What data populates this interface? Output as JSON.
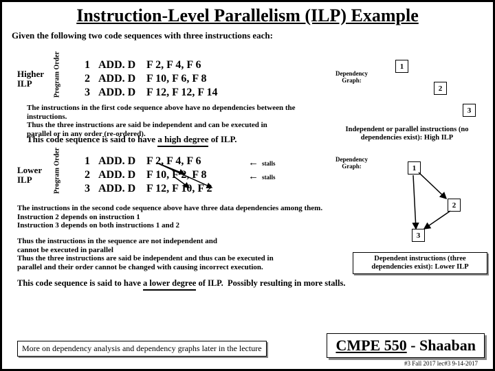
{
  "title": "Instruction-Level Parallelism (ILP) Example",
  "intro": "Given the following two code sequences with three instructions each:",
  "labels": {
    "higher": "Higher\nILP",
    "lower": "Lower\nILP",
    "prog_order": "Program  Order"
  },
  "higher": {
    "rows": [
      {
        "n": "1",
        "op": "ADD. D",
        "ops": "F 2, F 4, F 6"
      },
      {
        "n": "2",
        "op": "ADD. D",
        "ops": "F 10, F 6, F 8"
      },
      {
        "n": "3",
        "op": "ADD. D",
        "ops": "F 12, F 12, F 14"
      }
    ]
  },
  "lower": {
    "rows": [
      {
        "n": "1",
        "op": "ADD. D",
        "ops": "F 2, F 4, F 6"
      },
      {
        "n": "2",
        "op": "ADD. D",
        "ops": "F 10, F 2, F 8"
      },
      {
        "n": "3",
        "op": "ADD. D",
        "ops": "F 12, F 10, F 2"
      }
    ]
  },
  "graph_label": "Dependency\nGraph:",
  "para1": {
    "l1": "The instructions in the first code sequence above have no dependencies between the instructions.",
    "l2": "Thus the three instructions are said be independent and can be executed in",
    "l3": "parallel or in any order (re-ordered).",
    "concl": "This code sequence is said to have a high degree of ILP.",
    "side": "Independent or parallel instructions (no dependencies exist): High ILP"
  },
  "para2": {
    "l1": "The instructions in the second code sequence above have three data dependencies among them.",
    "l2": "Instruction 2 depends on instruction 1",
    "l3": "Instruction 3 depends on both instructions 1 and 2",
    "l4": "Thus the instructions in the sequence are not independent and",
    "l5": "cannot be executed in parallel",
    "l6": "Thus the three instructions are said be independent and thus can be executed in",
    "l7": "parallel and their order cannot be changed with causing incorrect execution.",
    "side": "Dependent instructions (three dependencies exist): Lower ILP",
    "concl": "This code sequence is said to have a lower degree of ILP.  Possibly resulting in more stalls."
  },
  "stalls": "stalls",
  "foot1": "More on dependency analysis and dependency graphs later in the lecture",
  "course": "CMPE 550 - Shaaban",
  "meta": "#3  Fall 2017    lec#3  9-14-2017"
}
